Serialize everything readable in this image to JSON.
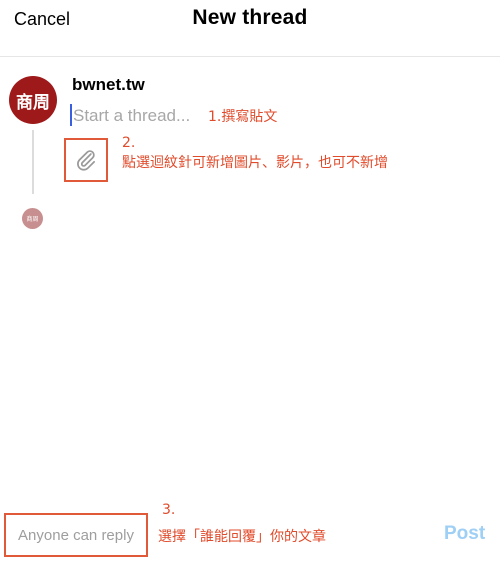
{
  "header": {
    "cancel_label": "Cancel",
    "title": "New thread"
  },
  "composer": {
    "avatar_text": "商周",
    "mini_avatar_text": "商周",
    "username": "bwnet.tw",
    "input_placeholder": "Start a thread..."
  },
  "annotations": {
    "step1": "1.撰寫貼文",
    "step2_number": "2.",
    "step2_text": "點選迴紋針可新增圖片、影片，也可不新增",
    "step3_number": "3.",
    "step3_text": "選擇「誰能回覆」你的文章"
  },
  "footer": {
    "reply_label": "Anyone can reply",
    "post_label": "Post"
  },
  "colors": {
    "avatar": "#9e1a1a",
    "annotation": "#e04b2b",
    "post_disabled": "#9ecff5",
    "caret": "#3a5fe0"
  },
  "icons": {
    "attach": "paperclip-icon"
  }
}
